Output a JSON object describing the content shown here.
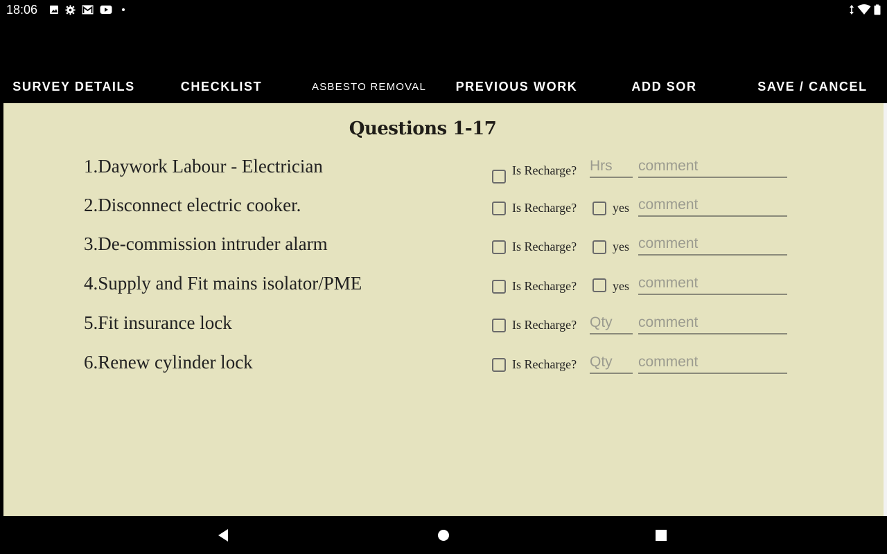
{
  "status_bar": {
    "time": "18:06",
    "left_icons": [
      "image-icon",
      "settings-icon",
      "gmail-icon",
      "youtube-icon",
      "dot-icon"
    ],
    "right_icons": [
      "data-arrows-icon",
      "wifi-icon",
      "battery-icon"
    ]
  },
  "tabs": [
    {
      "label": "SURVEY DETAILS"
    },
    {
      "label": "CHECKLIST"
    },
    {
      "label": "ASBESTO REMOVAL"
    },
    {
      "label": "PREVIOUS WORK"
    },
    {
      "label": "ADD SOR"
    },
    {
      "label": "SAVE / CANCEL"
    }
  ],
  "section": {
    "title": "Questions 1-17"
  },
  "questions": [
    {
      "text": "1.Daywork Labour - Electrician",
      "recharge_label": "Is Recharge?",
      "amount_placeholder": "Hrs",
      "comment_placeholder": "comment"
    },
    {
      "text": "2.Disconnect electric cooker.",
      "recharge_label": "Is Recharge?",
      "yes_label": "yes",
      "comment_placeholder": "comment"
    },
    {
      "text": "3.De-commission intruder alarm",
      "recharge_label": "Is Recharge?",
      "yes_label": "yes",
      "comment_placeholder": "comment"
    },
    {
      "text": "4.Supply and Fit mains isolator/PME",
      "recharge_label": "Is Recharge?",
      "yes_label": "yes",
      "comment_placeholder": "comment"
    },
    {
      "text": "5.Fit insurance lock",
      "recharge_label": "Is Recharge?",
      "amount_placeholder": "Qty",
      "comment_placeholder": "comment"
    },
    {
      "text": "6.Renew cylinder lock",
      "recharge_label": "Is Recharge?",
      "amount_placeholder": "Qty",
      "comment_placeholder": "comment"
    }
  ],
  "nav_bar": {
    "buttons": [
      "back-icon",
      "home-icon",
      "recents-icon"
    ]
  }
}
